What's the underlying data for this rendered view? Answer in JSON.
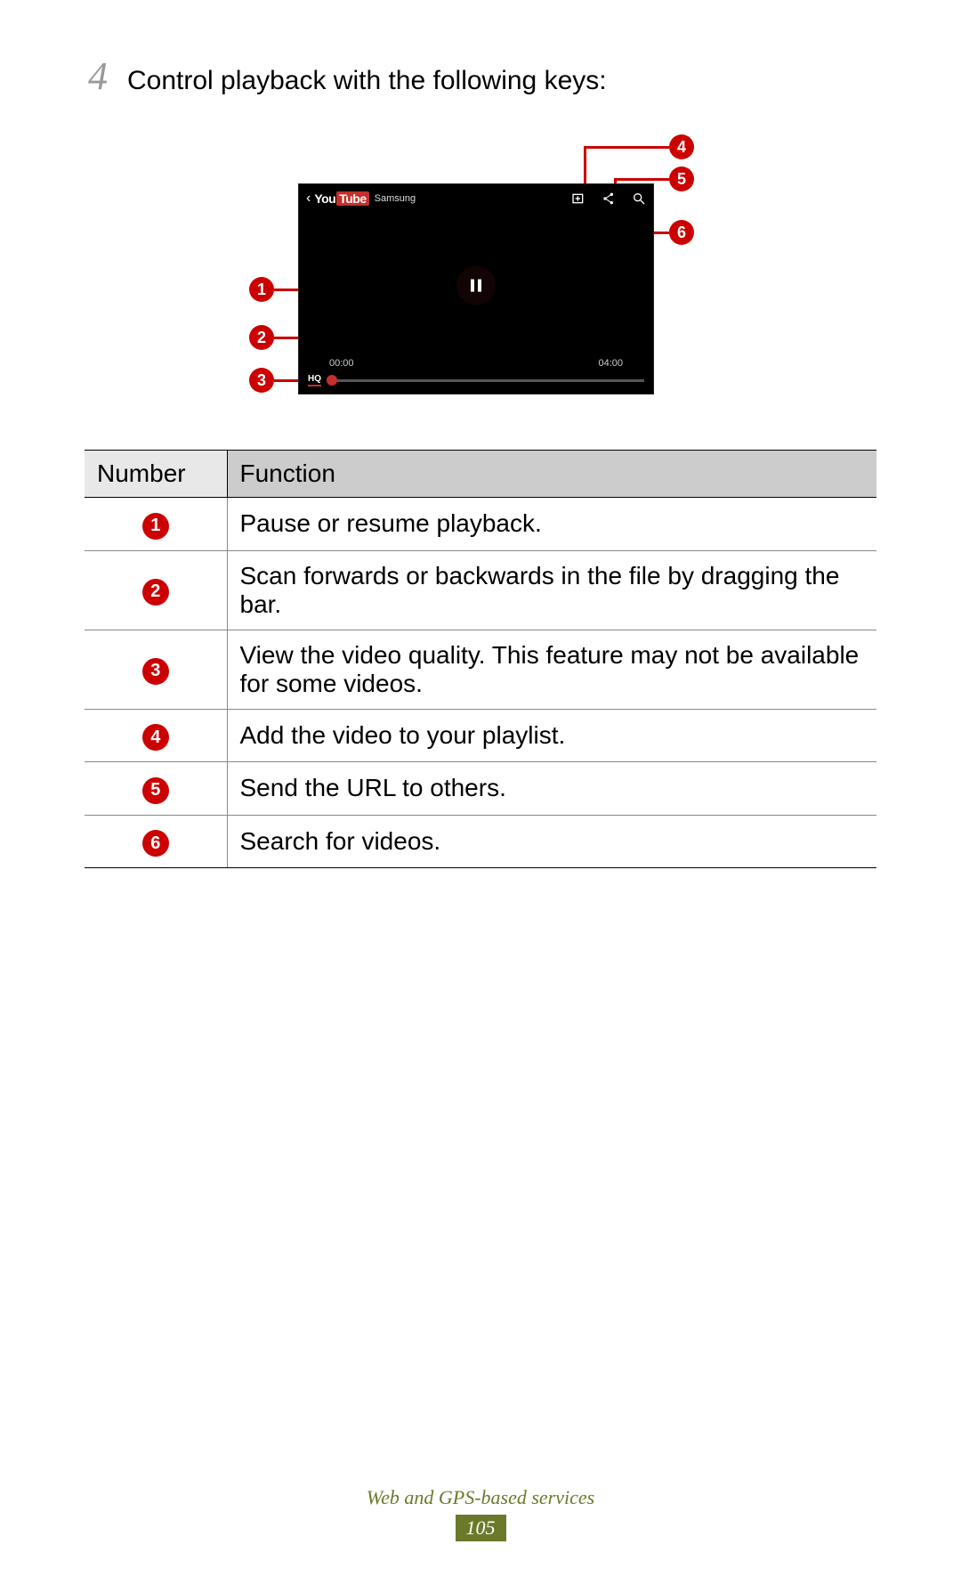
{
  "step": {
    "number": "4",
    "text": "Control playback with the following keys:"
  },
  "player": {
    "brand_you": "You",
    "brand_tube": "Tube",
    "title": "Samsung",
    "current_time": "00:00",
    "duration": "04:00",
    "hq_label": "HQ"
  },
  "callouts": {
    "c1": "1",
    "c2": "2",
    "c3": "3",
    "c4": "4",
    "c5": "5",
    "c6": "6"
  },
  "table": {
    "header_number": "Number",
    "header_function": "Function",
    "rows": [
      {
        "num": "1",
        "fn": "Pause or resume playback."
      },
      {
        "num": "2",
        "fn": "Scan forwards or backwards in the file by dragging the bar."
      },
      {
        "num": "3",
        "fn": "View the video quality. This feature may not be available for some videos."
      },
      {
        "num": "4",
        "fn": "Add the video to your playlist."
      },
      {
        "num": "5",
        "fn": "Send the URL to others."
      },
      {
        "num": "6",
        "fn": "Search for videos."
      }
    ]
  },
  "footer": {
    "section": "Web and GPS-based services",
    "page": "105"
  }
}
